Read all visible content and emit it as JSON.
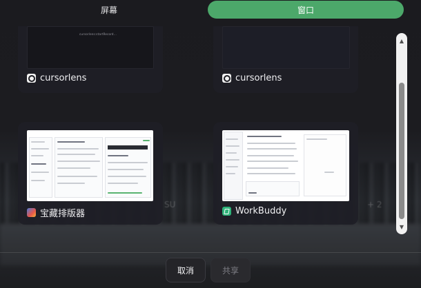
{
  "tabs": {
    "screen_label": "屏幕",
    "window_label": "窗口",
    "active": "window"
  },
  "windows": [
    {
      "title": "cursorlens",
      "icon": "cursorlens-icon",
      "preview_text": "cursorlens:startRecord..."
    },
    {
      "title": "cursorlens",
      "icon": "cursorlens-icon",
      "preview_text": ""
    },
    {
      "title": "宝藏排版器",
      "icon": "baozang-paibanqi-icon"
    },
    {
      "title": "WorkBuddy",
      "icon": "workbuddy-icon"
    }
  ],
  "background_text": {
    "left": "SU",
    "right": "+ 2"
  },
  "scrollbar": {
    "up_arrow": "▲",
    "down_arrow": "▼"
  },
  "footer": {
    "cancel_label": "取消",
    "share_label": "共享"
  },
  "colors": {
    "accent_green": "#4ca86a",
    "background": "#1a1a1e",
    "card": "#1e1e26"
  }
}
